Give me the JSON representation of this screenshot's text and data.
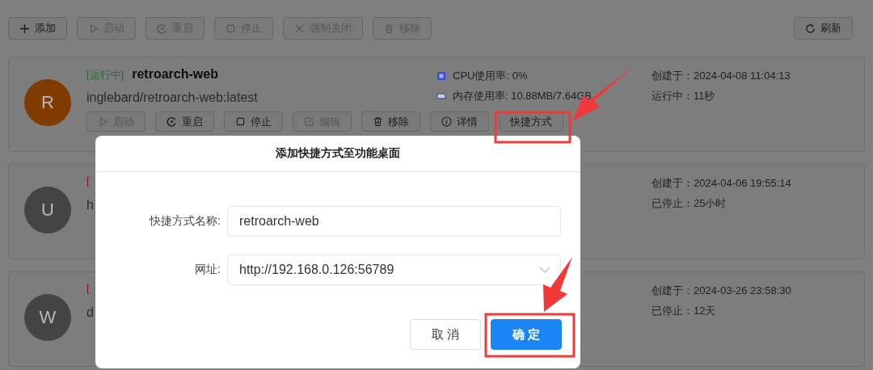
{
  "toolbar": {
    "buttons": [
      {
        "label": "添加",
        "kind": "plus",
        "disabled": false
      },
      {
        "label": "启动",
        "kind": "play",
        "disabled": true
      },
      {
        "label": "重启",
        "kind": "restart",
        "disabled": true
      },
      {
        "label": "停止",
        "kind": "stop",
        "disabled": true
      },
      {
        "label": "强制关闭",
        "kind": "close",
        "disabled": true
      },
      {
        "label": "移除",
        "kind": "trash",
        "disabled": true
      }
    ],
    "refresh": {
      "label": "刷新"
    }
  },
  "containers": [
    {
      "status": {
        "text": "[运行中]",
        "color": "#1e6e32"
      },
      "name": "retroarch-web",
      "avatar": {
        "letter": "R",
        "color": "#803c00"
      },
      "image": "inglebard/retroarch-web:latest",
      "cpu": "CPU使用率: 0%",
      "memory": "内存使用率: 10.88MB/7.64GB",
      "created": "创建于：2024-04-08 11:04:13",
      "uptime": "运行中：11秒",
      "buttons": [
        {
          "label": "启动",
          "kind": "play",
          "disabled": true
        },
        {
          "label": "重启",
          "kind": "restart",
          "disabled": false
        },
        {
          "label": "停止",
          "kind": "stop",
          "disabled": false
        },
        {
          "label": "编辑",
          "kind": "edit",
          "disabled": true
        },
        {
          "label": "移除",
          "kind": "trash",
          "disabled": false
        },
        {
          "label": "详情",
          "kind": "info",
          "disabled": false
        },
        {
          "label": "快捷方式",
          "kind": "text",
          "disabled": false
        }
      ]
    },
    {
      "status": {
        "text": "[",
        "color": "#8a1414"
      },
      "avatar": {
        "letter": "U",
        "color": "#444444"
      },
      "image": "h",
      "created": "创建于：2024-04-06 19:55:14",
      "uptime": "已停止：25小时"
    },
    {
      "status": {
        "text": "[",
        "color": "#8a1414"
      },
      "avatar": {
        "letter": "W",
        "color": "#444444"
      },
      "image": "d",
      "created": "创建于：2024-03-26 23:58:30",
      "uptime": "已停止：12天"
    }
  ],
  "dialog": {
    "title": "添加快捷方式至功能桌面",
    "fields": [
      {
        "kind": "text",
        "label": "快捷方式名称:",
        "value": "retroarch-web"
      },
      {
        "kind": "select",
        "label": "网址:",
        "value": "http://192.168.0.126:56789"
      }
    ],
    "buttons": [
      {
        "kind": "default",
        "label": "取 消"
      },
      {
        "kind": "primary",
        "label": "确 定"
      }
    ]
  }
}
